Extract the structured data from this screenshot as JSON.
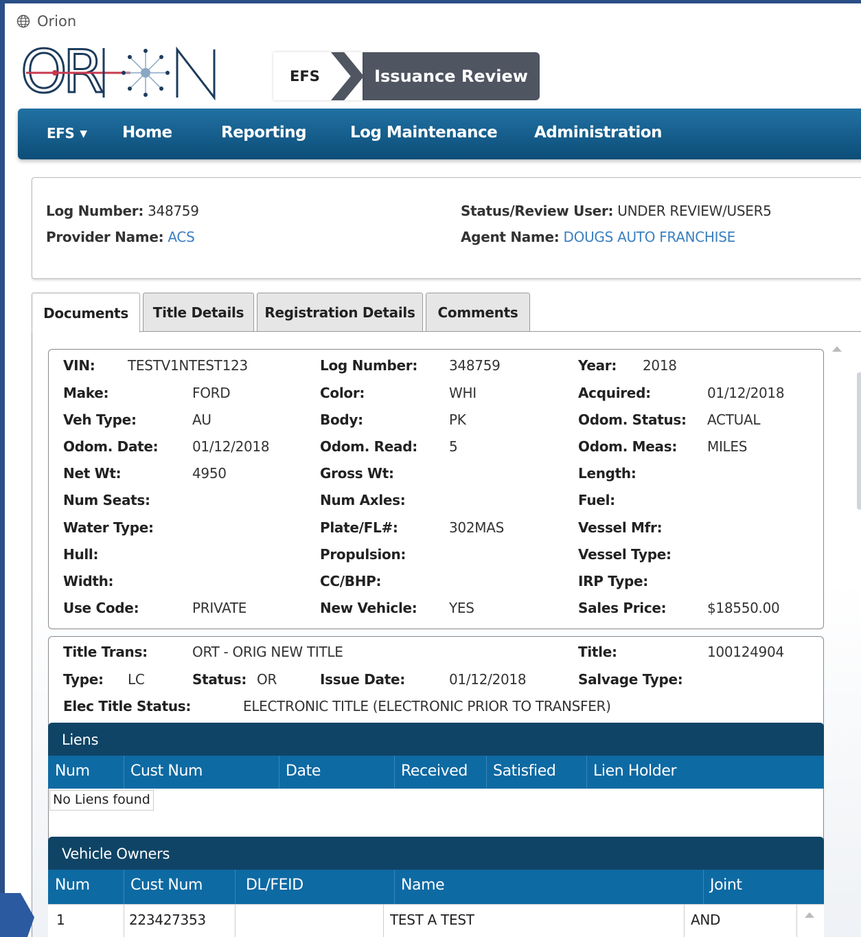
{
  "window": {
    "title": "Orion"
  },
  "logo": {
    "text": "ORION"
  },
  "breadcrumb": {
    "root": "EFS",
    "current": "Issuance Review"
  },
  "nav": {
    "efs": "EFS",
    "home": "Home",
    "reporting": "Reporting",
    "log_maintenance": "Log Maintenance",
    "administration": "Administration"
  },
  "header": {
    "log_number_label": "Log Number:",
    "log_number": "348759",
    "provider_label": "Provider Name:",
    "provider": "ACS",
    "status_label": "Status/Review User:",
    "status": "UNDER REVIEW/USER5",
    "agent_label": "Agent Name:",
    "agent": "DOUGS AUTO FRANCHISE"
  },
  "tabs": [
    "Documents",
    "Title Details",
    "Registration Details",
    "Comments"
  ],
  "vehicle": {
    "vin_label": "VIN:",
    "vin": "TESTV1NTEST123",
    "log_label": "Log Number:",
    "log": "348759",
    "year_label": "Year:",
    "year": "2018",
    "make_label": "Make:",
    "make": "FORD",
    "color_label": "Color:",
    "color": "WHI",
    "acquired_label": "Acquired:",
    "acquired": "01/12/2018",
    "vehtype_label": "Veh Type:",
    "vehtype": "AU",
    "body_label": "Body:",
    "body": "PK",
    "odomstatus_label": "Odom. Status:",
    "odomstatus": "ACTUAL",
    "odomdate_label": "Odom. Date:",
    "odomdate": "01/12/2018",
    "odomread_label": "Odom. Read:",
    "odomread": "5",
    "odommeas_label": "Odom. Meas:",
    "odommeas": "MILES",
    "netwt_label": "Net Wt:",
    "netwt": "4950",
    "grosswt_label": "Gross Wt:",
    "length_label": "Length:",
    "numseats_label": "Num Seats:",
    "numaxles_label": "Num Axles:",
    "fuel_label": "Fuel:",
    "watertype_label": "Water Type:",
    "plate_label": "Plate/FL#:",
    "plate": "302MAS",
    "vesselmfr_label": "Vessel Mfr:",
    "hull_label": "Hull:",
    "propulsion_label": "Propulsion:",
    "vesseltype_label": "Vessel Type:",
    "width_label": "Width:",
    "ccbhp_label": "CC/BHP:",
    "irptype_label": "IRP Type:",
    "usecode_label": "Use Code:",
    "usecode": "PRIVATE",
    "newvehicle_label": "New Vehicle:",
    "newvehicle": "YES",
    "salesprice_label": "Sales Price:",
    "salesprice": "$18550.00"
  },
  "title_info": {
    "trans_label": "Title Trans:",
    "trans": "ORT - ORIG NEW TITLE",
    "title_label": "Title:",
    "title": "100124904",
    "type_label": "Type:",
    "type": "LC",
    "status_label": "Status:",
    "status": "OR",
    "issue_label": "Issue Date:",
    "issue": "01/12/2018",
    "salvage_label": "Salvage Type:",
    "elec_label": "Elec Title Status:",
    "elec": "ELECTRONIC TITLE (ELECTRONIC PRIOR TO TRANSFER)"
  },
  "liens": {
    "title": "Liens",
    "columns": [
      "Num",
      "Cust Num",
      "Date",
      "Received",
      "Satisfied",
      "Lien Holder"
    ],
    "empty": "No Liens found"
  },
  "owners": {
    "title": "Vehicle Owners",
    "columns": [
      "Num",
      "Cust Num",
      "DL/FEID",
      "Name",
      "Joint"
    ],
    "rows": [
      {
        "num": "1",
        "cust_num": "223427353",
        "dl": "",
        "name": "TEST A TEST",
        "joint": "AND"
      }
    ]
  }
}
